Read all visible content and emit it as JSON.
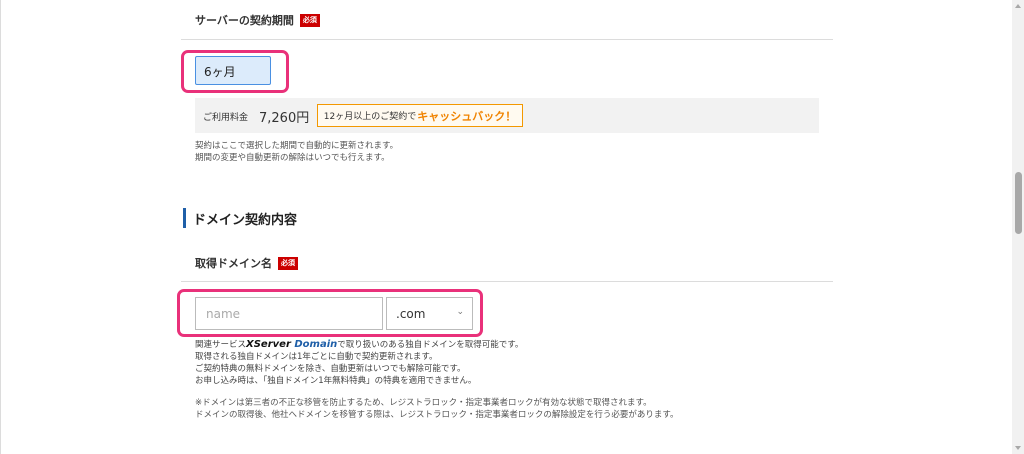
{
  "contract_period": {
    "label": "サーバーの契約期間",
    "required_badge": "必須",
    "selected_value": "6ヶ月"
  },
  "pricing": {
    "label": "ご利用料金",
    "value": "7,260円",
    "promo_text": "12ヶ月以上のご契約で",
    "promo_highlight": "キャッシュバック！"
  },
  "renewal_notes": [
    "契約はここで選択した期間で自動的に更新されます。",
    "期間の変更や自動更新の解除はいつでも行えます。"
  ],
  "domain_section": {
    "title": "ドメイン契約内容",
    "field_label": "取得ドメイン名",
    "required_badge": "必須",
    "input_placeholder": "name",
    "input_value": "",
    "tld_selected": ".com",
    "desc_prefix": "関連サービス",
    "brand_part1": "XServer",
    "brand_part2": "Domain",
    "desc_suffix": "で取り扱いのある独自ドメインを取得可能です。",
    "desc_lines": [
      "取得される独自ドメインは1年ごとに自動で契約更新されます。",
      "ご契約特典の無料ドメインを除き、自動更新はいつでも解除可能です。",
      "お申し込み時は、「独自ドメイン1年無料特典」の特典を適用できません。"
    ],
    "warnings": [
      "※ドメインは第三者の不正な移管を防止するため、レジストラロック・指定事業者ロックが有効な状態で取得されます。",
      "ドメインの取得後、他社へドメインを移管する際は、レジストラロック・指定事業者ロックの解除設定を行う必要があります。"
    ]
  },
  "icons": {
    "tld_dropdown": "chevron-down-icon"
  },
  "colors": {
    "required_badge": "#cc0000",
    "highlight_border": "#e9317a",
    "section_accent": "#1f5fa8",
    "promo_orange": "#f08300",
    "selected_field_bg": "#dcebfb"
  }
}
